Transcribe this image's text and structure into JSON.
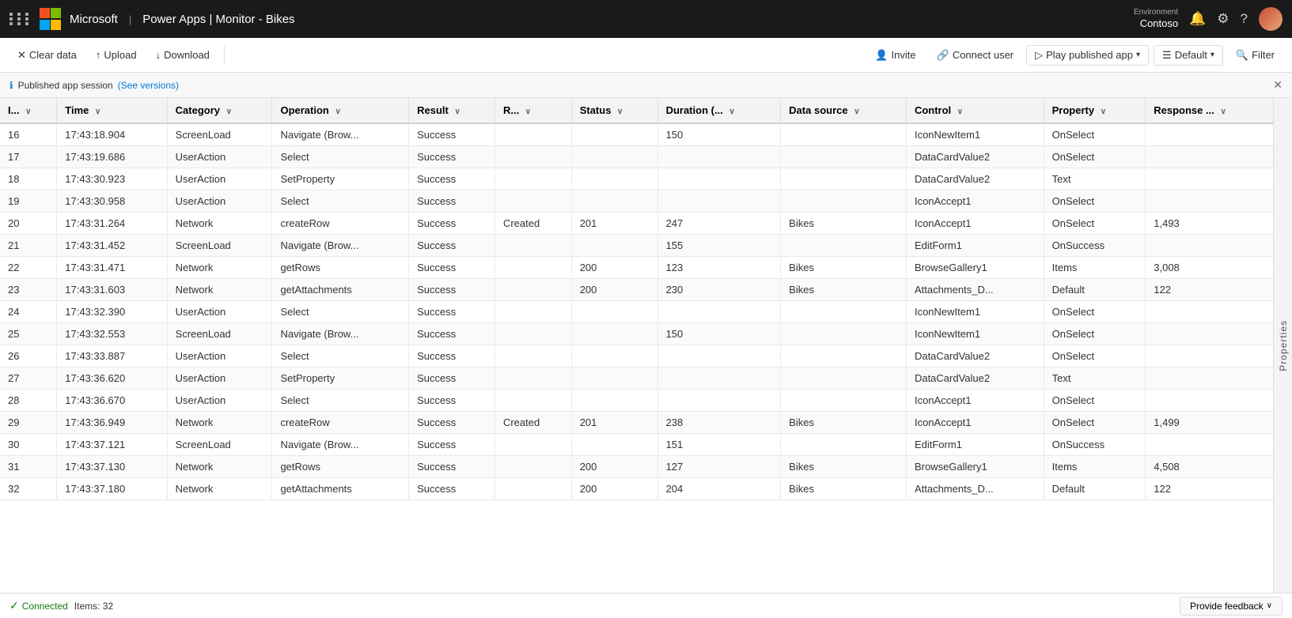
{
  "topbar": {
    "app_name": "Power Apps",
    "separator": "|",
    "monitor_title": "Monitor - Bikes",
    "env_label": "Environment",
    "env_name": "Contoso"
  },
  "toolbar": {
    "clear_data": "Clear data",
    "upload": "Upload",
    "download": "Download",
    "invite": "Invite",
    "connect_user": "Connect user",
    "play_published_app": "Play published app",
    "default": "Default",
    "filter": "Filter"
  },
  "infobar": {
    "text": "Published app session",
    "link_text": "(See versions)",
    "icon": "ℹ"
  },
  "table": {
    "columns": [
      {
        "id": "id",
        "label": "I...",
        "sortable": true
      },
      {
        "id": "time",
        "label": "Time",
        "sortable": true
      },
      {
        "id": "category",
        "label": "Category",
        "sortable": true
      },
      {
        "id": "operation",
        "label": "Operation",
        "sortable": true
      },
      {
        "id": "result",
        "label": "Result",
        "sortable": true
      },
      {
        "id": "r",
        "label": "R...",
        "sortable": true
      },
      {
        "id": "status",
        "label": "Status",
        "sortable": true
      },
      {
        "id": "duration",
        "label": "Duration (...",
        "sortable": true
      },
      {
        "id": "datasource",
        "label": "Data source",
        "sortable": true
      },
      {
        "id": "control",
        "label": "Control",
        "sortable": true
      },
      {
        "id": "property",
        "label": "Property",
        "sortable": true
      },
      {
        "id": "response",
        "label": "Response ...",
        "sortable": true
      }
    ],
    "rows": [
      {
        "id": "16",
        "time": "17:43:18.904",
        "category": "ScreenLoad",
        "operation": "Navigate (Brow...",
        "result": "Success",
        "r": "",
        "status": "",
        "duration": "150",
        "datasource": "",
        "control": "IconNewItem1",
        "property": "OnSelect",
        "response": ""
      },
      {
        "id": "17",
        "time": "17:43:19.686",
        "category": "UserAction",
        "operation": "Select",
        "result": "Success",
        "r": "",
        "status": "",
        "duration": "",
        "datasource": "",
        "control": "DataCardValue2",
        "property": "OnSelect",
        "response": ""
      },
      {
        "id": "18",
        "time": "17:43:30.923",
        "category": "UserAction",
        "operation": "SetProperty",
        "result": "Success",
        "r": "",
        "status": "",
        "duration": "",
        "datasource": "",
        "control": "DataCardValue2",
        "property": "Text",
        "response": ""
      },
      {
        "id": "19",
        "time": "17:43:30.958",
        "category": "UserAction",
        "operation": "Select",
        "result": "Success",
        "r": "",
        "status": "",
        "duration": "",
        "datasource": "",
        "control": "IconAccept1",
        "property": "OnSelect",
        "response": ""
      },
      {
        "id": "20",
        "time": "17:43:31.264",
        "category": "Network",
        "operation": "createRow",
        "result": "Success",
        "r": "Created",
        "status": "201",
        "duration": "247",
        "datasource": "Bikes",
        "control": "IconAccept1",
        "property": "OnSelect",
        "response": "1,493"
      },
      {
        "id": "21",
        "time": "17:43:31.452",
        "category": "ScreenLoad",
        "operation": "Navigate (Brow...",
        "result": "Success",
        "r": "",
        "status": "",
        "duration": "155",
        "datasource": "",
        "control": "EditForm1",
        "property": "OnSuccess",
        "response": ""
      },
      {
        "id": "22",
        "time": "17:43:31.471",
        "category": "Network",
        "operation": "getRows",
        "result": "Success",
        "r": "",
        "status": "200",
        "duration": "123",
        "datasource": "Bikes",
        "control": "BrowseGallery1",
        "property": "Items",
        "response": "3,008"
      },
      {
        "id": "23",
        "time": "17:43:31.603",
        "category": "Network",
        "operation": "getAttachments",
        "result": "Success",
        "r": "",
        "status": "200",
        "duration": "230",
        "datasource": "Bikes",
        "control": "Attachments_D...",
        "property": "Default",
        "response": "122"
      },
      {
        "id": "24",
        "time": "17:43:32.390",
        "category": "UserAction",
        "operation": "Select",
        "result": "Success",
        "r": "",
        "status": "",
        "duration": "",
        "datasource": "",
        "control": "IconNewItem1",
        "property": "OnSelect",
        "response": ""
      },
      {
        "id": "25",
        "time": "17:43:32.553",
        "category": "ScreenLoad",
        "operation": "Navigate (Brow...",
        "result": "Success",
        "r": "",
        "status": "",
        "duration": "150",
        "datasource": "",
        "control": "IconNewItem1",
        "property": "OnSelect",
        "response": ""
      },
      {
        "id": "26",
        "time": "17:43:33.887",
        "category": "UserAction",
        "operation": "Select",
        "result": "Success",
        "r": "",
        "status": "",
        "duration": "",
        "datasource": "",
        "control": "DataCardValue2",
        "property": "OnSelect",
        "response": ""
      },
      {
        "id": "27",
        "time": "17:43:36.620",
        "category": "UserAction",
        "operation": "SetProperty",
        "result": "Success",
        "r": "",
        "status": "",
        "duration": "",
        "datasource": "",
        "control": "DataCardValue2",
        "property": "Text",
        "response": ""
      },
      {
        "id": "28",
        "time": "17:43:36.670",
        "category": "UserAction",
        "operation": "Select",
        "result": "Success",
        "r": "",
        "status": "",
        "duration": "",
        "datasource": "",
        "control": "IconAccept1",
        "property": "OnSelect",
        "response": ""
      },
      {
        "id": "29",
        "time": "17:43:36.949",
        "category": "Network",
        "operation": "createRow",
        "result": "Success",
        "r": "Created",
        "status": "201",
        "duration": "238",
        "datasource": "Bikes",
        "control": "IconAccept1",
        "property": "OnSelect",
        "response": "1,499"
      },
      {
        "id": "30",
        "time": "17:43:37.121",
        "category": "ScreenLoad",
        "operation": "Navigate (Brow...",
        "result": "Success",
        "r": "",
        "status": "",
        "duration": "151",
        "datasource": "",
        "control": "EditForm1",
        "property": "OnSuccess",
        "response": ""
      },
      {
        "id": "31",
        "time": "17:43:37.130",
        "category": "Network",
        "operation": "getRows",
        "result": "Success",
        "r": "",
        "status": "200",
        "duration": "127",
        "datasource": "Bikes",
        "control": "BrowseGallery1",
        "property": "Items",
        "response": "4,508"
      },
      {
        "id": "32",
        "time": "17:43:37.180",
        "category": "Network",
        "operation": "getAttachments",
        "result": "Success",
        "r": "",
        "status": "200",
        "duration": "204",
        "datasource": "Bikes",
        "control": "Attachments_D...",
        "property": "Default",
        "response": "122"
      }
    ]
  },
  "statusbar": {
    "connected_label": "Connected",
    "items_label": "Items: 32",
    "feedback_btn": "Provide feedback"
  }
}
